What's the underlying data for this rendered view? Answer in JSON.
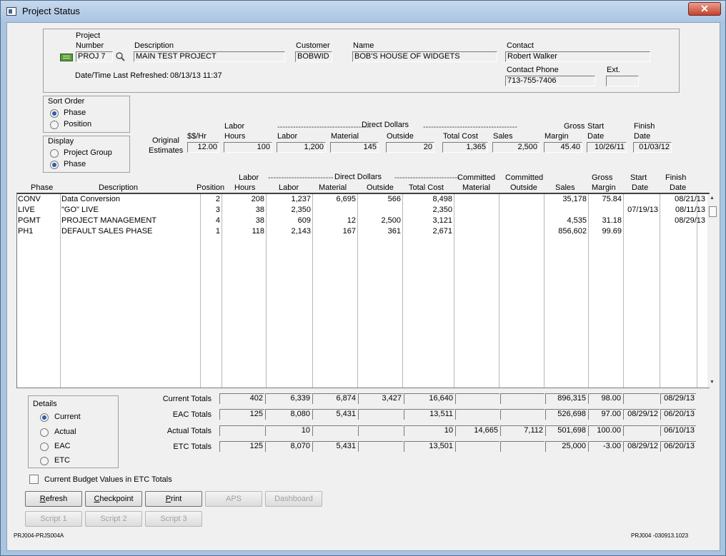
{
  "window": {
    "title": "Project Status",
    "close_glyph": "✕"
  },
  "header": {
    "project_number_label_1": "Project",
    "project_number_label_2": "Number",
    "project_number": "PROJ 7",
    "description_label": "Description",
    "description": "MAIN TEST PROJECT",
    "customer_label": "Customer",
    "customer": "BOBWID",
    "name_label": "Name",
    "name": "BOB'S HOUSE OF WIDGETS",
    "contact_label": "Contact",
    "contact": "Robert Walker",
    "refreshed_label": "Date/Time Last Refreshed:",
    "refreshed": "08/13/13 11:37",
    "phone_label": "Contact Phone",
    "phone": "713-755-7406",
    "ext_label": "Ext.",
    "ext": ""
  },
  "sort_order": {
    "title": "Sort Order",
    "options": [
      "Phase",
      "Position"
    ],
    "selected": "Phase"
  },
  "display": {
    "title": "Display",
    "options": [
      "Project Group",
      "Phase"
    ],
    "selected": "Phase"
  },
  "estimates": {
    "row_label_1": "Original",
    "row_label_2": "Estimates",
    "h_rate": "$$/Hr",
    "h_labor_1": "Labor",
    "h_labor_2": "Hours",
    "direct_dollars": "Direct Dollars",
    "dash_left": "------------------------------------",
    "dash_right": "------------------------------------",
    "h_labor": "Labor",
    "h_material": "Material",
    "h_outside": "Outside",
    "h_total_cost": "Total Cost",
    "h_sales": "Sales",
    "h_gross_1": "Gross",
    "h_gross_2": "Margin",
    "h_start_1": "Start",
    "h_start_2": "Date",
    "h_finish_1": "Finish",
    "h_finish_2": "Date",
    "rate": "12.00",
    "labor_hours": "100",
    "labor": "1,200",
    "material": "145",
    "outside": "20",
    "total_cost": "1,365",
    "sales": "2,500",
    "gross_margin": "45.40",
    "start_date": "10/26/11",
    "finish_date": "01/03/12"
  },
  "grid": {
    "headers": {
      "phase": "Phase",
      "description": "Description",
      "position": "Position",
      "labor_hours_1": "Labor",
      "labor_hours_2": "Hours",
      "direct_dollars": "Direct Dollars",
      "dash_left": "-------------------------",
      "dash_right": "-------------------------",
      "labor": "Labor",
      "material": "Material",
      "outside": "Outside",
      "total_cost": "Total Cost",
      "committed_1": "Committed",
      "committed_material": "Material",
      "committed_outside": "Outside",
      "sales": "Sales",
      "gross_1": "Gross",
      "gross_2": "Margin",
      "start_1": "Start",
      "start_2": "Date",
      "finish_1": "Finish",
      "finish_2": "Date"
    },
    "rows": [
      {
        "phase": "CONV",
        "description": "Data Conversion",
        "position": "2",
        "labor_hours": "208",
        "labor": "1,237",
        "material": "6,695",
        "outside": "566",
        "total_cost": "8,498",
        "committed_material": "",
        "committed_outside": "",
        "sales": "35,178",
        "gross_margin": "75.84",
        "start_date": "",
        "finish_date": "08/21/13"
      },
      {
        "phase": "LIVE",
        "description": "\"GO\" LIVE",
        "position": "3",
        "labor_hours": "38",
        "labor": "2,350",
        "material": "",
        "outside": "",
        "total_cost": "2,350",
        "committed_material": "",
        "committed_outside": "",
        "sales": "",
        "gross_margin": "",
        "start_date": "07/19/13",
        "finish_date": "08/11/13"
      },
      {
        "phase": "PGMT",
        "description": "PROJECT MANAGEMENT",
        "position": "4",
        "labor_hours": "38",
        "labor": "609",
        "material": "12",
        "outside": "2,500",
        "total_cost": "3,121",
        "committed_material": "",
        "committed_outside": "",
        "sales": "4,535",
        "gross_margin": "31.18",
        "start_date": "",
        "finish_date": "08/29/13"
      },
      {
        "phase": "PH1",
        "description": "DEFAULT SALES PHASE",
        "position": "1",
        "labor_hours": "118",
        "labor": "2,143",
        "material": "167",
        "outside": "361",
        "total_cost": "2,671",
        "committed_material": "",
        "committed_outside": "",
        "sales": "856,602",
        "gross_margin": "99.69",
        "start_date": "",
        "finish_date": ""
      }
    ]
  },
  "details": {
    "title": "Details",
    "options": [
      "Current",
      "Actual",
      "EAC",
      "ETC"
    ],
    "selected": "Current"
  },
  "totals": [
    {
      "label": "Current Totals",
      "labor_hours": "402",
      "labor": "6,339",
      "material": "6,874",
      "outside": "3,427",
      "total_cost": "16,640",
      "committed_material": "",
      "committed_outside": "",
      "sales": "896,315",
      "gross_margin": "98.00",
      "start_date": "",
      "finish_date": "08/29/13"
    },
    {
      "label": "EAC Totals",
      "labor_hours": "125",
      "labor": "8,080",
      "material": "5,431",
      "outside": "",
      "total_cost": "13,511",
      "committed_material": "",
      "committed_outside": "",
      "sales": "526,698",
      "gross_margin": "97.00",
      "start_date": "08/29/12",
      "finish_date": "06/20/13"
    },
    {
      "label": "Actual Totals",
      "labor_hours": "",
      "labor": "10",
      "material": "",
      "outside": "",
      "total_cost": "10",
      "committed_material": "14,665",
      "committed_outside": "7,112",
      "sales": "501,698",
      "gross_margin": "100.00",
      "start_date": "",
      "finish_date": "06/10/13"
    },
    {
      "label": "ETC Totals",
      "labor_hours": "125",
      "labor": "8,070",
      "material": "5,431",
      "outside": "",
      "total_cost": "13,501",
      "committed_material": "",
      "committed_outside": "",
      "sales": "25,000",
      "gross_margin": "-3.00",
      "start_date": "08/29/12",
      "finish_date": "06/20/13"
    }
  ],
  "budget_checkbox": {
    "label": "Current Budget Values in ETC Totals",
    "checked": false
  },
  "buttons": {
    "refresh": "Refresh",
    "checkpoint": "Checkpoint",
    "print": "Print",
    "aps": "APS",
    "dashboard": "Dashboard",
    "script1": "Script 1",
    "script2": "Script 2",
    "script3": "Script 3"
  },
  "footer": {
    "left": "PRJ004-PRJS004A",
    "right": "PRJ004 -030913.1023"
  },
  "colors": {
    "title_bar": "#aac4e1",
    "close_button": "#c4412b",
    "window_bg": "#f0f0f0",
    "radio_selected": "#2d5ea8",
    "search_icon": "#3a7a2a"
  },
  "icons": {
    "project_icon": "green-card-icon",
    "search": "magnifier-icon",
    "scroll_up": "▲",
    "scroll_down": "▼"
  }
}
